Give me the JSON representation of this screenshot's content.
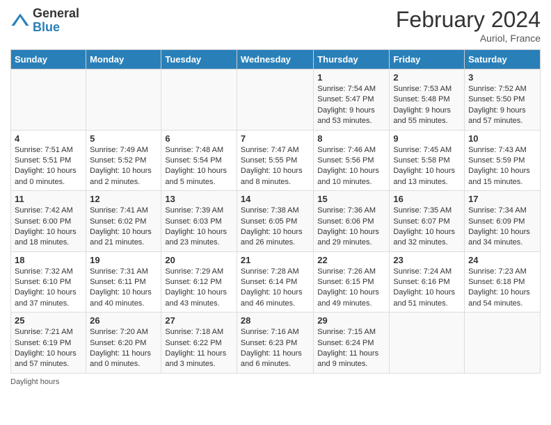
{
  "logo": {
    "general": "General",
    "blue": "Blue"
  },
  "title": {
    "month_year": "February 2024",
    "location": "Auriol, France"
  },
  "days_of_week": [
    "Sunday",
    "Monday",
    "Tuesday",
    "Wednesday",
    "Thursday",
    "Friday",
    "Saturday"
  ],
  "weeks": [
    [
      {
        "day": "",
        "info": ""
      },
      {
        "day": "",
        "info": ""
      },
      {
        "day": "",
        "info": ""
      },
      {
        "day": "",
        "info": ""
      },
      {
        "day": "1",
        "info": "Sunrise: 7:54 AM\nSunset: 5:47 PM\nDaylight: 9 hours and 53 minutes."
      },
      {
        "day": "2",
        "info": "Sunrise: 7:53 AM\nSunset: 5:48 PM\nDaylight: 9 hours and 55 minutes."
      },
      {
        "day": "3",
        "info": "Sunrise: 7:52 AM\nSunset: 5:50 PM\nDaylight: 9 hours and 57 minutes."
      }
    ],
    [
      {
        "day": "4",
        "info": "Sunrise: 7:51 AM\nSunset: 5:51 PM\nDaylight: 10 hours and 0 minutes."
      },
      {
        "day": "5",
        "info": "Sunrise: 7:49 AM\nSunset: 5:52 PM\nDaylight: 10 hours and 2 minutes."
      },
      {
        "day": "6",
        "info": "Sunrise: 7:48 AM\nSunset: 5:54 PM\nDaylight: 10 hours and 5 minutes."
      },
      {
        "day": "7",
        "info": "Sunrise: 7:47 AM\nSunset: 5:55 PM\nDaylight: 10 hours and 8 minutes."
      },
      {
        "day": "8",
        "info": "Sunrise: 7:46 AM\nSunset: 5:56 PM\nDaylight: 10 hours and 10 minutes."
      },
      {
        "day": "9",
        "info": "Sunrise: 7:45 AM\nSunset: 5:58 PM\nDaylight: 10 hours and 13 minutes."
      },
      {
        "day": "10",
        "info": "Sunrise: 7:43 AM\nSunset: 5:59 PM\nDaylight: 10 hours and 15 minutes."
      }
    ],
    [
      {
        "day": "11",
        "info": "Sunrise: 7:42 AM\nSunset: 6:00 PM\nDaylight: 10 hours and 18 minutes."
      },
      {
        "day": "12",
        "info": "Sunrise: 7:41 AM\nSunset: 6:02 PM\nDaylight: 10 hours and 21 minutes."
      },
      {
        "day": "13",
        "info": "Sunrise: 7:39 AM\nSunset: 6:03 PM\nDaylight: 10 hours and 23 minutes."
      },
      {
        "day": "14",
        "info": "Sunrise: 7:38 AM\nSunset: 6:05 PM\nDaylight: 10 hours and 26 minutes."
      },
      {
        "day": "15",
        "info": "Sunrise: 7:36 AM\nSunset: 6:06 PM\nDaylight: 10 hours and 29 minutes."
      },
      {
        "day": "16",
        "info": "Sunrise: 7:35 AM\nSunset: 6:07 PM\nDaylight: 10 hours and 32 minutes."
      },
      {
        "day": "17",
        "info": "Sunrise: 7:34 AM\nSunset: 6:09 PM\nDaylight: 10 hours and 34 minutes."
      }
    ],
    [
      {
        "day": "18",
        "info": "Sunrise: 7:32 AM\nSunset: 6:10 PM\nDaylight: 10 hours and 37 minutes."
      },
      {
        "day": "19",
        "info": "Sunrise: 7:31 AM\nSunset: 6:11 PM\nDaylight: 10 hours and 40 minutes."
      },
      {
        "day": "20",
        "info": "Sunrise: 7:29 AM\nSunset: 6:12 PM\nDaylight: 10 hours and 43 minutes."
      },
      {
        "day": "21",
        "info": "Sunrise: 7:28 AM\nSunset: 6:14 PM\nDaylight: 10 hours and 46 minutes."
      },
      {
        "day": "22",
        "info": "Sunrise: 7:26 AM\nSunset: 6:15 PM\nDaylight: 10 hours and 49 minutes."
      },
      {
        "day": "23",
        "info": "Sunrise: 7:24 AM\nSunset: 6:16 PM\nDaylight: 10 hours and 51 minutes."
      },
      {
        "day": "24",
        "info": "Sunrise: 7:23 AM\nSunset: 6:18 PM\nDaylight: 10 hours and 54 minutes."
      }
    ],
    [
      {
        "day": "25",
        "info": "Sunrise: 7:21 AM\nSunset: 6:19 PM\nDaylight: 10 hours and 57 minutes."
      },
      {
        "day": "26",
        "info": "Sunrise: 7:20 AM\nSunset: 6:20 PM\nDaylight: 11 hours and 0 minutes."
      },
      {
        "day": "27",
        "info": "Sunrise: 7:18 AM\nSunset: 6:22 PM\nDaylight: 11 hours and 3 minutes."
      },
      {
        "day": "28",
        "info": "Sunrise: 7:16 AM\nSunset: 6:23 PM\nDaylight: 11 hours and 6 minutes."
      },
      {
        "day": "29",
        "info": "Sunrise: 7:15 AM\nSunset: 6:24 PM\nDaylight: 11 hours and 9 minutes."
      },
      {
        "day": "",
        "info": ""
      },
      {
        "day": "",
        "info": ""
      }
    ]
  ],
  "footer": {
    "daylight_hours": "Daylight hours"
  }
}
